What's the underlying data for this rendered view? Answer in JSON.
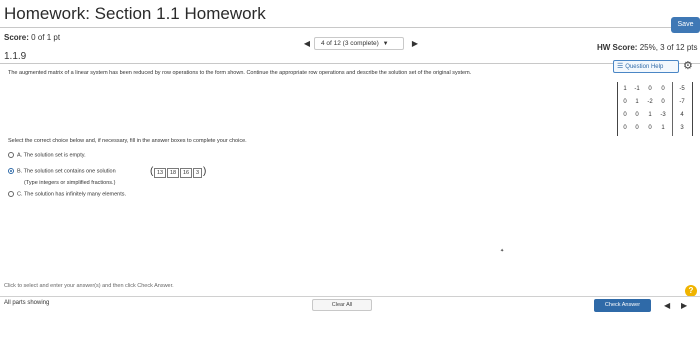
{
  "header": {
    "title": "Homework: Section 1.1 Homework",
    "save_label": "Save"
  },
  "score": {
    "label": "Score:",
    "value": "0 of 1 pt"
  },
  "question_number": "1.1.9",
  "question_nav": {
    "prev_icon": "triangle-left-icon",
    "selector_text": "4 of 12 (3 complete)",
    "next_icon": "triangle-right-icon"
  },
  "hw_score": {
    "label": "HW Score:",
    "value": "25%, 3 of 12 pts"
  },
  "question_help_label": "Question Help",
  "prompt": "The augmented matrix of a linear system has been reduced by row operations to the form shown. Continue the appropriate row operations and describe the solution set of the original system.",
  "matrix": [
    [
      "1",
      "-1",
      "0",
      "0",
      "-5"
    ],
    [
      "0",
      "1",
      "-2",
      "0",
      "-7"
    ],
    [
      "0",
      "0",
      "1",
      "-3",
      "4"
    ],
    [
      "0",
      "0",
      "0",
      "1",
      "3"
    ]
  ],
  "instruction": "Select the correct choice below and, if necessary, fill in the answer boxes to complete your choice.",
  "options": {
    "a": {
      "letter": "A.",
      "text": "The solution set is empty."
    },
    "b": {
      "letter": "B.",
      "text": "The solution set contains one solution",
      "answers": [
        "13",
        "18",
        "16",
        "3"
      ],
      "note": "(Type integers or simplified fractions.)"
    },
    "c": {
      "letter": "C.",
      "text": "The solution has infinitely many elements."
    }
  },
  "selected_option": "B",
  "footer": {
    "instruction": "Click to select and enter your answer(s) and then click Check Answer.",
    "parts_showing": "All parts showing",
    "clear_all": "Clear All",
    "check_answer": "Check Answer",
    "help_icon": "?"
  },
  "colors": {
    "accent": "#2f6aa8",
    "save_button": "#3f78b5",
    "help_badge": "#f0b400"
  }
}
